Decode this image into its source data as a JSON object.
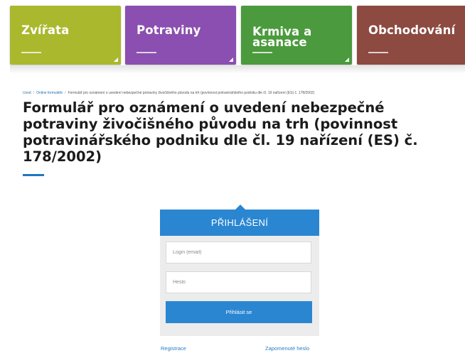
{
  "categories": [
    {
      "label": "Zvířata",
      "color": "#aab82e"
    },
    {
      "label": "Potraviny",
      "color": "#8a4fb0"
    },
    {
      "label": "Krmiva a\nasanace",
      "color": "#4b9a3d"
    },
    {
      "label": "Obchodování",
      "color": "#8c4a40"
    }
  ],
  "breadcrumb": {
    "home": "Úvod",
    "section": "Online formuláře",
    "current": "Formulář pro oznámení o uvedení nebezpečné potraviny živočišného původu na trh (povinnost potravinářského podniku dle čl. 19 nařízení (ES) č. 178/2002)"
  },
  "page": {
    "title": "Formulář pro oznámení o uvedení nebezpečné potraviny živočišného původu na trh (povinnost potravinářského podniku dle čl. 19 nařízení (ES) č. 178/2002)",
    "accent_color": "#1f78c1"
  },
  "login": {
    "title": "PŘIHLÁŠENÍ",
    "login_placeholder": "Login (email)",
    "password_placeholder": "Heslo",
    "submit_label": "Přihlásit se",
    "register_link": "Registrace",
    "forgot_link": "Zapomenuté heslo",
    "accent_color": "#2a86d1"
  }
}
